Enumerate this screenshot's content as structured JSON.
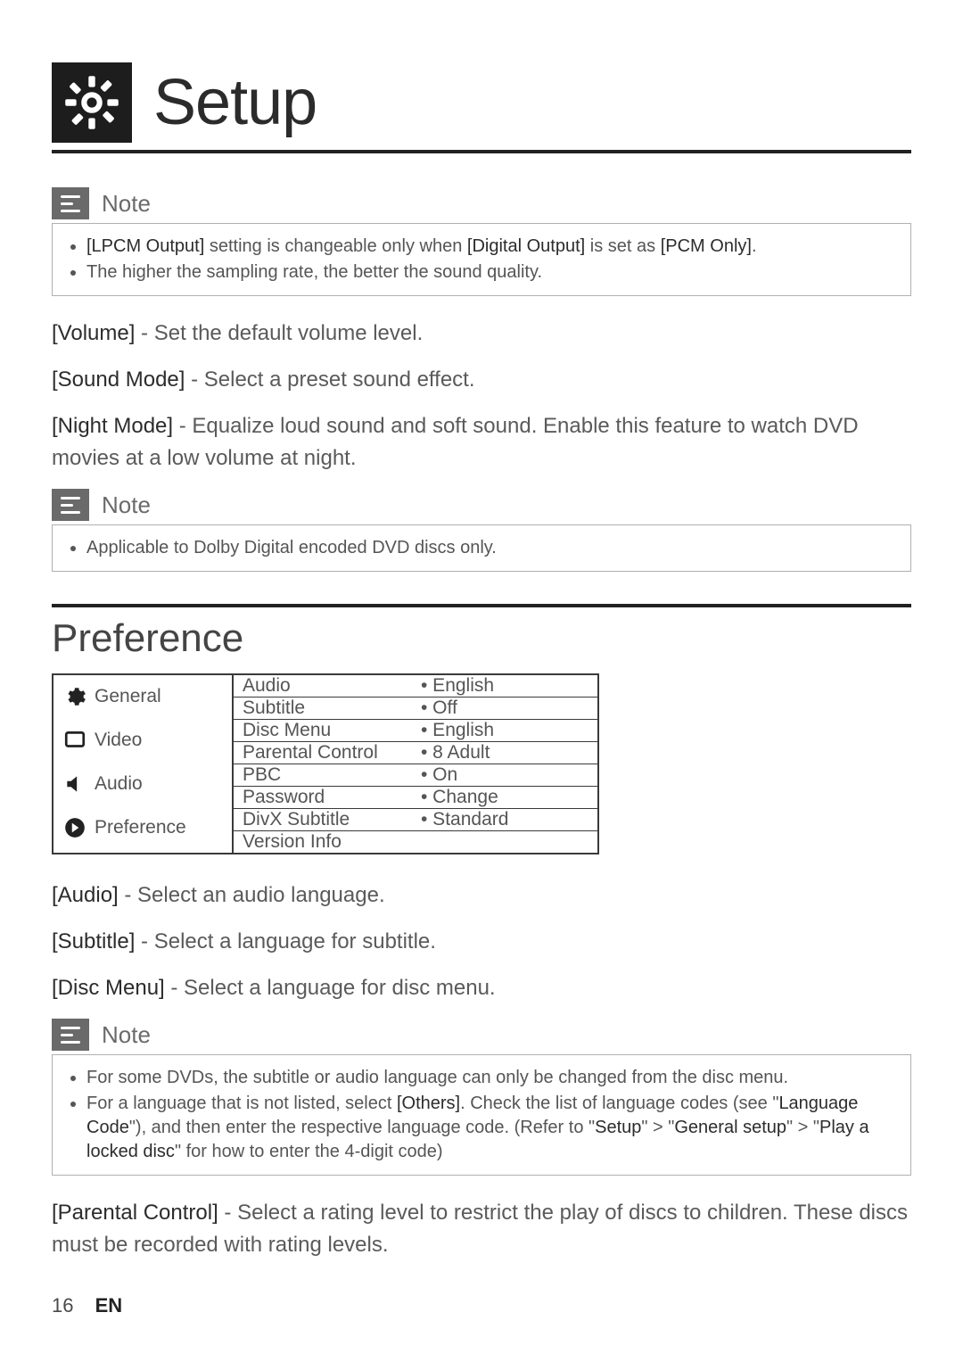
{
  "header": {
    "title": "Setup",
    "icon": "gear-icon"
  },
  "notes": {
    "label": "Note",
    "note1_items": [
      "[LPCM Output] setting is changeable only when [Digital Output] is set as [PCM Only].",
      "The higher the sampling rate, the better the sound quality."
    ],
    "note2_items": [
      "Applicable to Dolby Digital encoded DVD discs only."
    ],
    "note3_items": [
      "For some DVDs, the subtitle or audio language can only be changed from the disc menu.",
      "For a language that is not listed, select [Others]. Check the list of language codes (see \"Language Code\"), and then enter the respective language code. (Refer to \"Setup\" > \"General setup\" > \"Play a locked disc\" for how to enter the 4-digit code)"
    ]
  },
  "body": {
    "volume_label": "[Volume]",
    "volume_text": " - Set the default volume level.",
    "sound_label": "[Sound Mode]",
    "sound_text": " - Select a preset sound effect.",
    "night_label": "[Night Mode]",
    "night_text": " - Equalize loud sound and soft sound. Enable this feature to watch DVD movies at a low volume at night."
  },
  "section": {
    "title": "Preference"
  },
  "menu": {
    "left": [
      {
        "icon": "gear-icon",
        "label": "General"
      },
      {
        "icon": "screen-icon",
        "label": "Video"
      },
      {
        "icon": "speaker-icon",
        "label": "Audio"
      },
      {
        "icon": "pref-icon",
        "label": "Preference"
      }
    ],
    "right": [
      {
        "k": "Audio",
        "v": "• English"
      },
      {
        "k": "Subtitle",
        "v": "• Off"
      },
      {
        "k": "Disc Menu",
        "v": "• English"
      },
      {
        "k": "Parental Control",
        "v": "• 8 Adult"
      },
      {
        "k": "PBC",
        "v": "• On"
      },
      {
        "k": "Password",
        "v": "• Change"
      },
      {
        "k": "DivX Subtitle",
        "v": "• Standard"
      },
      {
        "k": "Version Info",
        "v": ""
      }
    ]
  },
  "defs": {
    "audio_label": "[Audio]",
    "audio_text": " - Select an audio language.",
    "subtitle_label": "[Subtitle]",
    "subtitle_text": " - Select a language for subtitle.",
    "disc_label": "[Disc Menu]",
    "disc_text": " - Select a language for disc menu.",
    "parental_label": "[Parental Control]",
    "parental_text": " - Select a rating level to restrict the play of discs to children. These discs must be recorded with rating levels."
  },
  "footer": {
    "page": "16",
    "lang": "EN"
  },
  "note1_bold": {
    "a": "[LPCM Output]",
    "b": "[Digital Output]",
    "c": "[PCM Only]"
  },
  "note3_bold": {
    "a": "[Others]",
    "b": "Language Code",
    "c": "Setup",
    "d": "General setup",
    "e": "Play a locked disc"
  }
}
